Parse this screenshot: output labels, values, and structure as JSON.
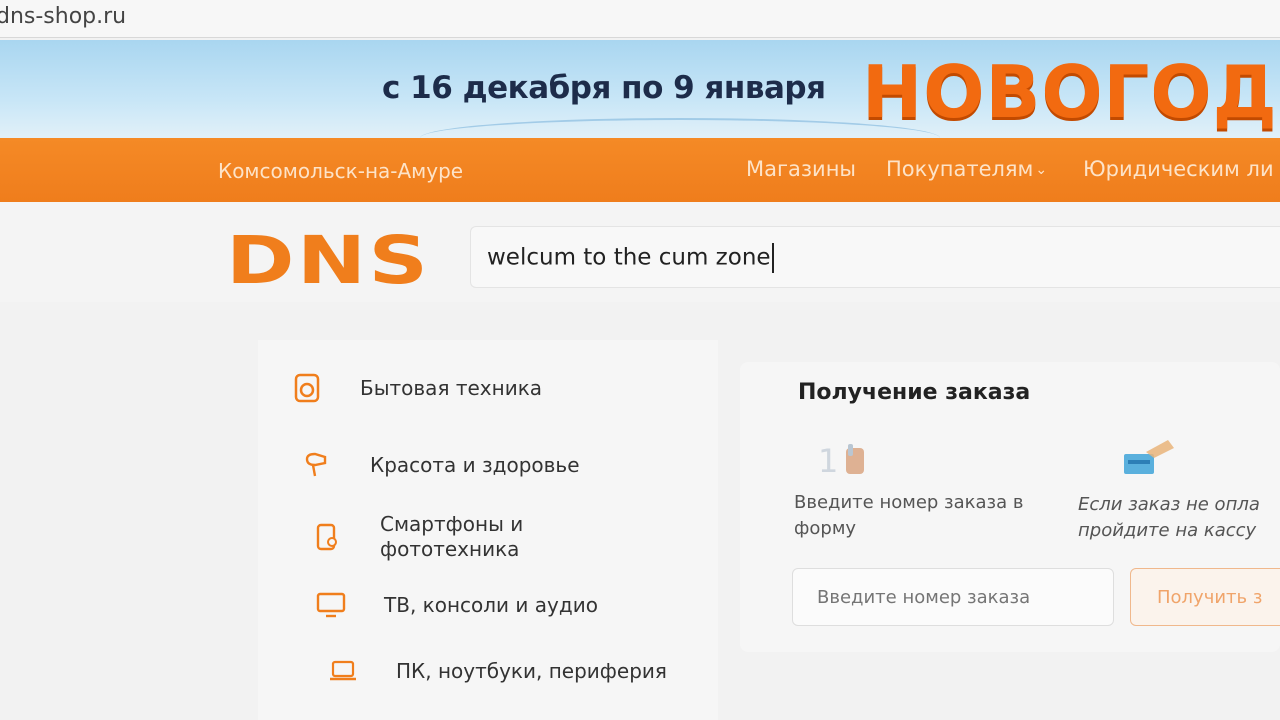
{
  "browser": {
    "url": "dns-shop.ru"
  },
  "promo": {
    "dates": "с 16 декабря по 9 января",
    "title": "НОВОГОДНИ"
  },
  "topnav": {
    "city": "Комсомольск-на-Амуре",
    "stores": "Магазины",
    "buyers": "Покупателям",
    "legal": "Юридическим ли"
  },
  "header": {
    "logo": "DNS",
    "search_value": "welcum to the cum zone"
  },
  "catalog": {
    "items": [
      {
        "label": "Бытовая техника",
        "icon": "washing-machine-icon"
      },
      {
        "label": "Красота и здоровье",
        "icon": "hair-dryer-icon"
      },
      {
        "label": "Смартфоны и фототехника",
        "icon": "smartphone-icon"
      },
      {
        "label": "ТВ, консоли и аудио",
        "icon": "tv-icon"
      },
      {
        "label": "ПК, ноутбуки, периферия",
        "icon": "laptop-icon"
      }
    ]
  },
  "pickup": {
    "title": "Получение заказа",
    "step1": "Введите номер заказа в форму",
    "step2": "Если заказ не опла пройдите на кассу",
    "input_placeholder": "Введите номер заказа",
    "button_label": "Получить з"
  },
  "colors": {
    "brand_orange": "#f07e1c",
    "nav_orange": "#f58a26",
    "promo_blue": "#a9d6f0"
  }
}
